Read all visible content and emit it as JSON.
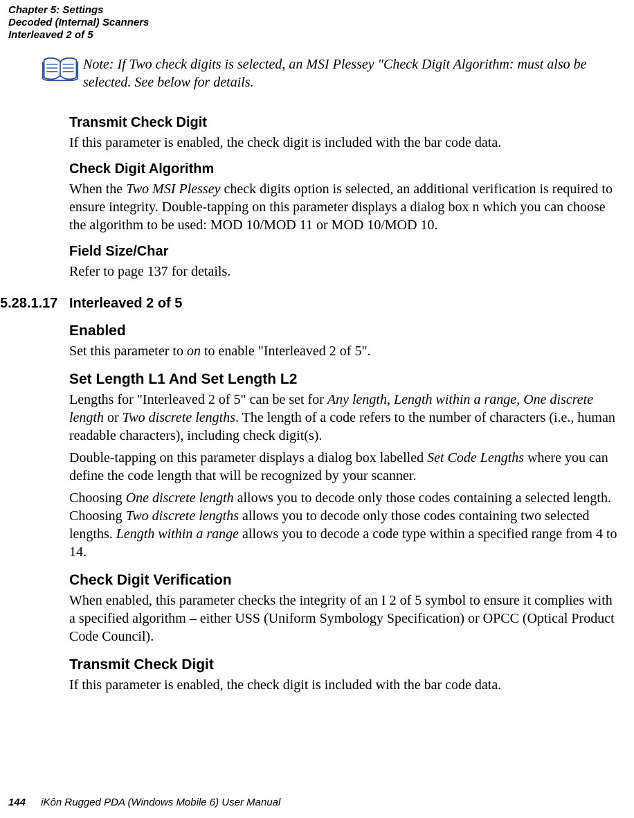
{
  "header": {
    "line1": "Chapter 5: Settings",
    "line2": "Decoded (Internal) Scanners",
    "line3": "Interleaved 2 of 5"
  },
  "note": {
    "label": "Note:",
    "text": "If Two check digits is selected, an MSI Plessey \"Check Digit Algorithm: must also be selected. See below for details."
  },
  "s1": {
    "h": "Transmit Check Digit",
    "p": "If this parameter is enabled, the check digit is included with the bar code data."
  },
  "s2": {
    "h": "Check Digit Algorithm",
    "p_pre": "When the ",
    "p_em": "Two MSI Plessey",
    "p_post": " check digits option is selected, an additional verification is required to ensure integrity. Double-tapping on this parameter displays a dialog box n which you can choose the algorithm to be used: MOD 10/MOD 11 or MOD 10/MOD 10."
  },
  "s3": {
    "h": "Field Size/Char",
    "p": "Refer to page 137 for details."
  },
  "sec": {
    "num": "5.28.1.17",
    "title": "Interleaved 2 of 5"
  },
  "en": {
    "h": "Enabled",
    "p_pre": "Set this parameter to ",
    "p_em": "on",
    "p_post": " to enable \"Interleaved 2 of 5\"."
  },
  "len": {
    "h": "Set Length L1 And Set Length L2",
    "p1_a": "Lengths for \"Interleaved 2 of 5\" can be set for ",
    "p1_em1": "Any length",
    "p1_b": ", ",
    "p1_em2": "Length within a range",
    "p1_c": ", ",
    "p1_em3": "One discrete length",
    "p1_d": " or ",
    "p1_em4": "Two discrete lengths",
    "p1_e": ". The length of a code refers to the number of characters (i.e., human readable characters), including check digit(s).",
    "p2_a": "Double-tapping on this parameter displays a dialog box labelled ",
    "p2_em": "Set Code Lengths",
    "p2_b": " where you can define the code length that will be recognized by your scanner.",
    "p3_a": "Choosing ",
    "p3_em1": "One discrete length",
    "p3_b": " allows you to decode only those codes containing a selected length. Choosing ",
    "p3_em2": "Two discrete lengths",
    "p3_c": " allows you to decode only those codes containing two selected lengths. ",
    "p3_em3": "Length within a range",
    "p3_d": " allows you to decode a code type within a specified range from 4 to 14."
  },
  "cdv": {
    "h": "Check Digit Verification",
    "p": "When enabled, this parameter checks the integrity of an I 2 of 5 symbol to ensure it complies with a specified algorithm – either USS (Uniform Symbology Specification) or OPCC (Optical Product Code Council)."
  },
  "tcd": {
    "h": "Transmit Check Digit",
    "p": "If this parameter is enabled, the check digit is included with the bar code data."
  },
  "footer": {
    "page": "144",
    "title": "iKôn Rugged PDA (Windows Mobile 6) User Manual"
  }
}
